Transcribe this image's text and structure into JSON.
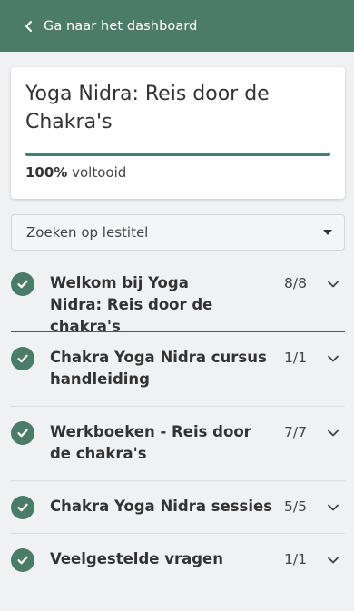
{
  "header": {
    "back_label": "Ga naar het dashboard"
  },
  "course": {
    "title": "Yoga Nidra: Reis door de Chakra's",
    "progress": {
      "percent": 100,
      "percent_label": "100%",
      "suffix": " voltooid"
    }
  },
  "search": {
    "placeholder": "Zoeken op lestitel"
  },
  "sections": [
    {
      "title": "Welkom bij Yoga Nidra: Reis door de chakra's",
      "count": "8/8"
    },
    {
      "title": "Chakra Yoga Nidra cursus handleiding",
      "count": "1/1"
    },
    {
      "title": "Werkboeken - Reis door de chakra's",
      "count": "7/7"
    },
    {
      "title": "Chakra Yoga Nidra sessies",
      "count": "5/5"
    },
    {
      "title": "Veelgestelde vragen",
      "count": "1/1"
    }
  ],
  "colors": {
    "accent": "#4b7c69",
    "background": "#f0f1f3"
  }
}
